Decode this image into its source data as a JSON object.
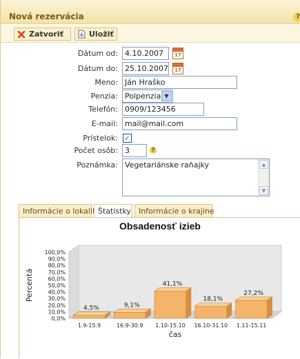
{
  "window": {
    "title": "Nová rezervácia",
    "help_label": "?"
  },
  "toolbar": {
    "close_label": "Zatvoriť",
    "save_label": "Uložiť"
  },
  "form": {
    "date_from": {
      "label": "Dátum od:",
      "value": "4.10.2007",
      "calendar_label": "17"
    },
    "date_to": {
      "label": "Dátum do:",
      "value": "25.10.2007",
      "calendar_label": "17"
    },
    "name": {
      "label": "Meno:",
      "value": "Ján Hraško"
    },
    "board": {
      "label": "Penzia:",
      "value": "Polpenzia"
    },
    "phone": {
      "label": "Telefón:",
      "value": "0909/123456"
    },
    "email": {
      "label": "E-mail:",
      "value": "mail@mail.com"
    },
    "extra_bed": {
      "label": "Prístelok:",
      "checked": true
    },
    "guests": {
      "label": "Počet osôb:",
      "value": "3",
      "hint_label": "?"
    },
    "note": {
      "label": "Poznámka:",
      "value": "Vegetariánske raňajky"
    }
  },
  "tabs": [
    {
      "label": "Informácie o lokalite",
      "active": false
    },
    {
      "label": "Štatistky",
      "active": true
    },
    {
      "label": "Informácie o krajine",
      "active": false
    }
  ],
  "chart_data": {
    "type": "bar",
    "title": "Obsadenosť izieb",
    "xlabel": "čas",
    "ylabel": "Percentá",
    "categories": [
      "1.9-15.9",
      "16.9-30.9",
      "1.10-15.10",
      "16.10-31.10",
      "1.11-15.11"
    ],
    "values": [
      4.5,
      9.1,
      41.1,
      18.1,
      27.2
    ],
    "data_labels": [
      "4,5%",
      "9,1%",
      "41,1%",
      "18,1%",
      "27,2%"
    ],
    "ylim": [
      0,
      100
    ],
    "yticks": [
      "0,0%",
      "10,0%",
      "20,0%",
      "30,0%",
      "40,0%",
      "50,0%",
      "60,0%",
      "70,0%",
      "80,0%",
      "90,0%",
      "100,0%"
    ],
    "grid": false,
    "legend": "none",
    "bar_color": "#f4b46a",
    "bar_top_color": "#f9cf92",
    "bar_side_color": "#d98e3e",
    "wall_color": "#e8e8e8"
  }
}
